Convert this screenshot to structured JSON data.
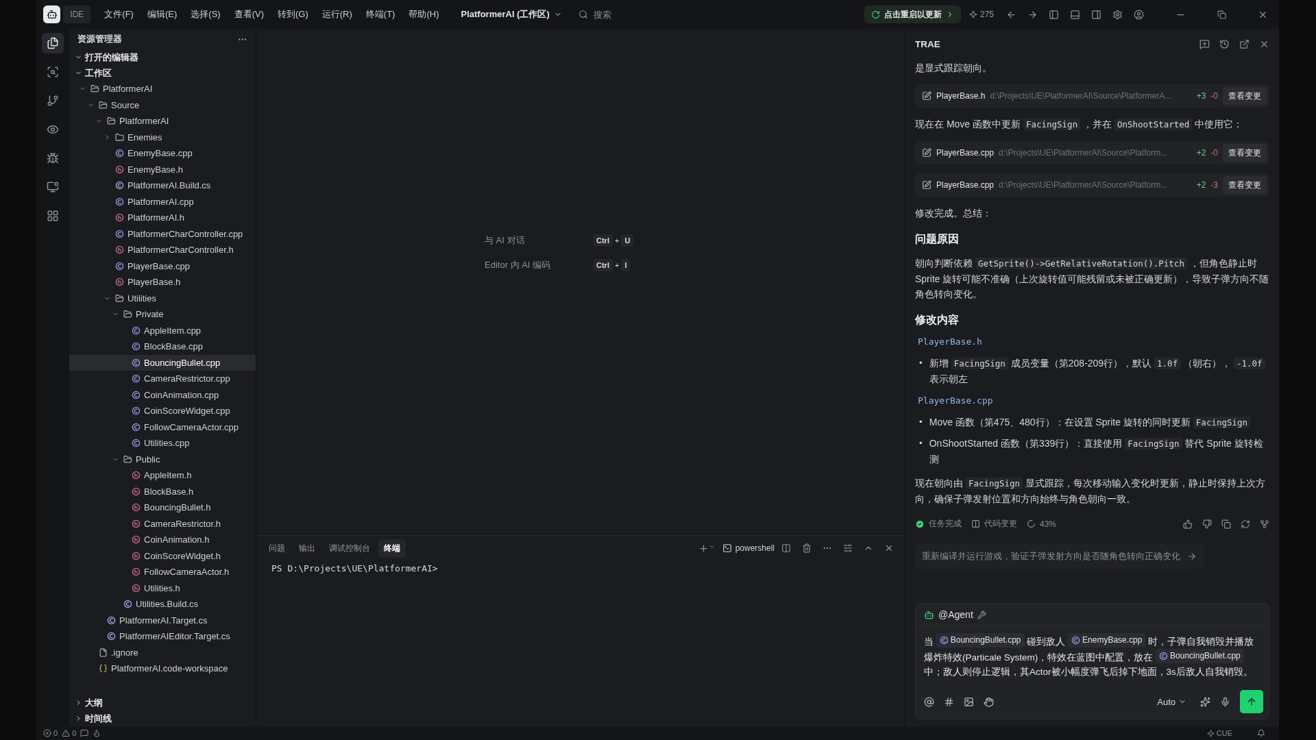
{
  "title_bar": {
    "app_label": "IDE",
    "menu": [
      "文件(F)",
      "编辑(E)",
      "选择(S)",
      "查看(V)",
      "转到(G)",
      "运行(R)",
      "终端(T)",
      "帮助(H)"
    ],
    "workspace": "PlatformerAI (工作区)",
    "search": {
      "placeholder": "搜索"
    },
    "update": "点击重启以更新",
    "count": "275"
  },
  "activity_bar": [
    {
      "kind": "files",
      "selected": true
    },
    {
      "kind": "search",
      "selected": false
    },
    {
      "kind": "branch",
      "selected": false
    },
    {
      "kind": "eye",
      "selected": false
    },
    {
      "kind": "bug",
      "selected": false
    },
    {
      "kind": "monitor",
      "selected": false
    },
    {
      "kind": "grid",
      "selected": false
    }
  ],
  "sidebar": {
    "title": "资源管理器",
    "sections": [
      {
        "label": "打开的编辑器",
        "expanded": true
      },
      {
        "label": "工作区",
        "expanded": true
      }
    ],
    "tree": [
      {
        "name": "PlatformerAI",
        "kind": "folder",
        "expanded": true,
        "selected": false,
        "children": [
          {
            "name": "Source",
            "kind": "folder",
            "expanded": true,
            "selected": false,
            "children": [
              {
                "name": "PlatformerAI",
                "kind": "folder",
                "expanded": true,
                "selected": false,
                "children": [
                  {
                    "name": "Enemies",
                    "kind": "folder",
                    "expanded": false,
                    "selected": false
                  },
                  {
                    "name": "EnemyBase.cpp",
                    "kind": "cpp",
                    "selected": false
                  },
                  {
                    "name": "EnemyBase.h",
                    "kind": "h",
                    "selected": false
                  },
                  {
                    "name": "PlatformerAI.Build.cs",
                    "kind": "cs",
                    "selected": false
                  },
                  {
                    "name": "PlatformerAI.cpp",
                    "kind": "cpp",
                    "selected": false
                  },
                  {
                    "name": "PlatformerAI.h",
                    "kind": "h",
                    "selected": false
                  },
                  {
                    "name": "PlatformerCharController.cpp",
                    "kind": "cpp",
                    "selected": false
                  },
                  {
                    "name": "PlatformerCharController.h",
                    "kind": "h",
                    "selected": false
                  },
                  {
                    "name": "PlayerBase.cpp",
                    "kind": "cpp",
                    "selected": false
                  },
                  {
                    "name": "PlayerBase.h",
                    "kind": "h",
                    "selected": false
                  },
                  {
                    "name": "Utilities",
                    "kind": "folder",
                    "expanded": true,
                    "selected": false,
                    "children": [
                      {
                        "name": "Private",
                        "kind": "folder",
                        "expanded": true,
                        "selected": false,
                        "children": [
                          {
                            "name": "AppleItem.cpp",
                            "kind": "cpp",
                            "selected": false
                          },
                          {
                            "name": "BlockBase.cpp",
                            "kind": "cpp",
                            "selected": false
                          },
                          {
                            "name": "BouncingBullet.cpp",
                            "kind": "cpp",
                            "selected": true
                          },
                          {
                            "name": "CameraRestrictor.cpp",
                            "kind": "cpp",
                            "selected": false
                          },
                          {
                            "name": "CoinAnimation.cpp",
                            "kind": "cpp",
                            "selected": false
                          },
                          {
                            "name": "CoinScoreWidget.cpp",
                            "kind": "cpp",
                            "selected": false
                          },
                          {
                            "name": "FollowCameraActor.cpp",
                            "kind": "cpp",
                            "selected": false
                          },
                          {
                            "name": "Utilities.cpp",
                            "kind": "cpp",
                            "selected": false
                          }
                        ]
                      },
                      {
                        "name": "Public",
                        "kind": "folder",
                        "expanded": true,
                        "selected": false,
                        "children": [
                          {
                            "name": "AppleItem.h",
                            "kind": "h",
                            "selected": false
                          },
                          {
                            "name": "BlockBase.h",
                            "kind": "h",
                            "selected": false
                          },
                          {
                            "name": "BouncingBullet.h",
                            "kind": "h",
                            "selected": false
                          },
                          {
                            "name": "CameraRestrictor.h",
                            "kind": "h",
                            "selected": false
                          },
                          {
                            "name": "CoinAnimation.h",
                            "kind": "h",
                            "selected": false
                          },
                          {
                            "name": "CoinScoreWidget.h",
                            "kind": "h",
                            "selected": false
                          },
                          {
                            "name": "FollowCameraActor.h",
                            "kind": "h",
                            "selected": false
                          },
                          {
                            "name": "Utilities.h",
                            "kind": "h",
                            "selected": false
                          }
                        ]
                      },
                      {
                        "name": "Utilities.Build.cs",
                        "kind": "cs",
                        "selected": false
                      }
                    ]
                  }
                ]
              },
              {
                "name": "PlatformerAI.Target.cs",
                "kind": "cs",
                "selected": false
              },
              {
                "name": "PlatformerAIEditor.Target.cs",
                "kind": "cs",
                "selected": false
              }
            ]
          },
          {
            "name": ".ignore",
            "kind": "file",
            "selected": false
          },
          {
            "name": "PlatformerAI.code-workspace",
            "kind": "workspace",
            "selected": false
          }
        ]
      }
    ],
    "footer_sections": [
      {
        "label": "大纲",
        "expanded": false
      },
      {
        "label": "时间线",
        "expanded": false
      }
    ]
  },
  "editor": {
    "hints": [
      {
        "label": "与 AI 对话",
        "keys": [
          "Ctrl",
          "U"
        ],
        "joiner": "+"
      },
      {
        "label": "Editor 内 AI 编码",
        "keys": [
          "Ctrl",
          "I"
        ],
        "joiner": "+"
      }
    ]
  },
  "panel": {
    "tabs": [
      {
        "label": "问题",
        "selected": false
      },
      {
        "label": "输出",
        "selected": false
      },
      {
        "label": "调试控制台",
        "selected": false
      },
      {
        "label": "终端",
        "selected": true
      }
    ],
    "shell": "powershell",
    "prompt": "PS D:\\Projects\\UE\\PlatformerAI>"
  },
  "chat": {
    "title": "TRAE",
    "blocks": [
      {
        "kind": "paragraph",
        "parts": [
          {
            "kind": "text",
            "text": "是显式跟踪朝向。"
          }
        ]
      },
      {
        "kind": "change",
        "file": "PlayerBase.h",
        "path": "d:\\Projects\\UE\\PlatformerAI\\Source\\PlatformerA...",
        "added": "+3",
        "removed": "-0",
        "action": "查看变更"
      },
      {
        "kind": "paragraph",
        "parts": [
          {
            "kind": "text",
            "text": "现在在 Move 函数中更新 "
          },
          {
            "kind": "code",
            "text": "FacingSign"
          },
          {
            "kind": "text",
            "text": " ，并在 "
          },
          {
            "kind": "code",
            "text": "OnShootStarted"
          },
          {
            "kind": "text",
            "text": " 中使用它："
          }
        ]
      },
      {
        "kind": "change",
        "file": "PlayerBase.cpp",
        "path": "d:\\Projects\\UE\\PlatformerAI\\Source\\Platform...",
        "added": "+2",
        "removed": "-0",
        "action": "查看变更"
      },
      {
        "kind": "change",
        "file": "PlayerBase.cpp",
        "path": "d:\\Projects\\UE\\PlatformerAI\\Source\\Platform...",
        "added": "+2",
        "removed": "-3",
        "action": "查看变更"
      },
      {
        "kind": "paragraph",
        "parts": [
          {
            "kind": "text",
            "text": "修改完成。总结："
          }
        ]
      },
      {
        "kind": "heading",
        "text": "问题原因"
      },
      {
        "kind": "paragraph",
        "parts": [
          {
            "kind": "text",
            "text": "朝向判断依赖 "
          },
          {
            "kind": "code",
            "text": "GetSprite()->GetRelativeRotation().Pitch"
          },
          {
            "kind": "text",
            "text": " ，但角色静止时 Sprite 旋转可能不准确（上次旋转值可能残留或未被正确更新），导致子弹方向不随角色转向变化。"
          }
        ]
      },
      {
        "kind": "heading",
        "text": "修改内容"
      },
      {
        "kind": "file_label",
        "text": "PlayerBase.h"
      },
      {
        "kind": "bullets",
        "marker": "•",
        "items": [
          [
            {
              "kind": "text",
              "text": "新增 "
            },
            {
              "kind": "code",
              "text": "FacingSign"
            },
            {
              "kind": "text",
              "text": " 成员变量（第208-209行），默认 "
            },
            {
              "kind": "code",
              "text": "1.0f"
            },
            {
              "kind": "text",
              "text": " （朝右）， "
            },
            {
              "kind": "code",
              "text": "-1.0f"
            },
            {
              "kind": "text",
              "text": " 表示朝左"
            }
          ]
        ]
      },
      {
        "kind": "file_label",
        "text": "PlayerBase.cpp"
      },
      {
        "kind": "bullets",
        "marker": "•",
        "items": [
          [
            {
              "kind": "text",
              "text": "Move 函数（第475、480行）：在设置 Sprite 旋转的同时更新 "
            },
            {
              "kind": "code",
              "text": "FacingSign"
            }
          ],
          [
            {
              "kind": "text",
              "text": "OnShootStarted 函数（第339行）：直接使用 "
            },
            {
              "kind": "code",
              "text": "FacingSign"
            },
            {
              "kind": "text",
              "text": " 替代 Sprite 旋转检测"
            }
          ]
        ]
      },
      {
        "kind": "paragraph",
        "parts": [
          {
            "kind": "text",
            "text": "现在朝向由 "
          },
          {
            "kind": "code",
            "text": "FacingSign"
          },
          {
            "kind": "text",
            "text": " 显式跟踪，每次移动输入变化时更新，静止时保持上次方向，确保子弹发射位置和方向始终与角色朝向一致。"
          }
        ]
      }
    ],
    "status": {
      "done": "任务完成",
      "changes": "代码变更",
      "progress": "43%"
    },
    "suggestion": "重新编译并运行游戏，验证子弹发射方向是否随角色转向正确变化",
    "input": {
      "agent": "@Agent",
      "parts": [
        {
          "kind": "text",
          "text": "当 "
        },
        {
          "kind": "file",
          "text": "BouncingBullet.cpp"
        },
        {
          "kind": "text",
          "text": " 碰到敌人 "
        },
        {
          "kind": "file",
          "text": "EnemyBase.cpp"
        },
        {
          "kind": "text",
          "text": " 时，子弹自我销毁并播放爆炸特效(Particale System)，特效在蓝图中配置，放在 "
        },
        {
          "kind": "file",
          "text": "BouncingBullet.cpp"
        },
        {
          "kind": "text",
          "text": " 中；敌人则停止逻辑，其Actor被小幅度弹飞后掉下地面，3s后敌人自我销毁。"
        }
      ],
      "mode": "Auto"
    }
  },
  "status_bar": {
    "errors": "0",
    "warnings": "0",
    "right": "CUE"
  }
}
